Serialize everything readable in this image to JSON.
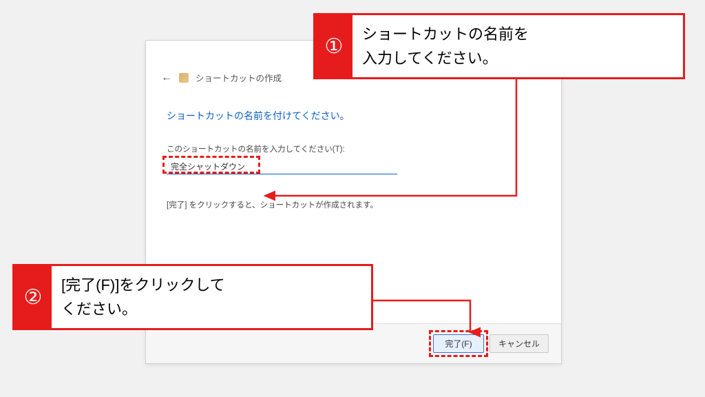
{
  "dialog": {
    "title": "ショートカットの作成",
    "heading": "ショートカットの名前を付けてください。",
    "input_label": "このショートカットの名前を入力してください(T):",
    "input_value": "完全シャットダウン",
    "hint": "[完了] をクリックすると、ショートカットが作成されます。",
    "finish_label": "完了(F)",
    "cancel_label": "キャンセル",
    "close_glyph": "×",
    "back_glyph": "←"
  },
  "callouts": {
    "one": {
      "badge": "①",
      "text": "ショートカットの名前を\n入力してください。"
    },
    "two": {
      "badge": "②",
      "text": "[完了(F)]をクリックして\nください。"
    }
  },
  "colors": {
    "accent_red": "#e61c1c",
    "link_blue": "#0a5fc7"
  }
}
